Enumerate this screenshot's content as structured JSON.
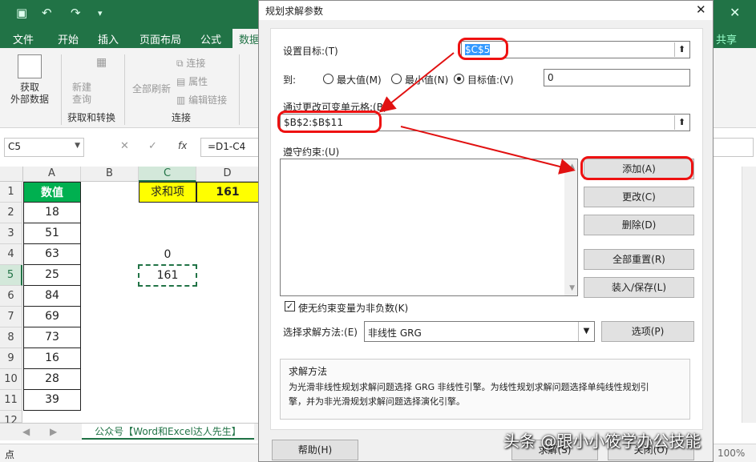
{
  "qat": {
    "icons": [
      "save-icon",
      "undo-icon",
      "redo-icon",
      "customize-icon"
    ]
  },
  "ribbon_tabs": [
    "文件",
    "开始",
    "插入",
    "页面布局",
    "公式",
    "数据"
  ],
  "share_label": "共享",
  "ribbon": {
    "get_external": "获取\n外部数据",
    "new_query": "新建\n查询",
    "refresh_all": "全部刷新",
    "connections": "连接",
    "properties": "属性",
    "edit_links": "编辑链接",
    "group1": "获取和转换",
    "group2": "连接"
  },
  "formula_bar": {
    "name_box": "C5",
    "fx": "fx",
    "formula": "=D1-C4"
  },
  "columns": [
    "A",
    "B",
    "C",
    "D"
  ],
  "rows": [
    "1",
    "2",
    "3",
    "4",
    "5",
    "6",
    "7",
    "8",
    "9",
    "10",
    "11",
    "12"
  ],
  "cells": {
    "A1": "数值",
    "A_values": [
      "18",
      "51",
      "63",
      "25",
      "84",
      "69",
      "73",
      "16",
      "28",
      "39"
    ],
    "C1": "求和项",
    "D1": "161",
    "C4": "0",
    "C5": "161"
  },
  "sheet_tab": "公众号【Word和Excel达人先生】",
  "status": {
    "left": "点",
    "zoom": "100%"
  },
  "dialog": {
    "title": "规划求解参数",
    "set_objective_label": "设置目标:(T)",
    "objective_value": "$C$5",
    "to_label": "到:",
    "max_label": "最大值(M)",
    "min_label": "最小值(N)",
    "target_label": "目标值:(V)",
    "target_value": "0",
    "changing_label": "通过更改可变单元格:(B)",
    "changing_value": "$B$2:$B$11",
    "constraints_label": "遵守约束:(U)",
    "add": "添加(A)",
    "change": "更改(C)",
    "delete": "删除(D)",
    "reset_all": "全部重置(R)",
    "load_save": "装入/保存(L)",
    "nonneg_label": "使无约束变量为非负数(K)",
    "method_label": "选择求解方法:(E)",
    "method_value": "非线性 GRG",
    "options": "选项(P)",
    "desc_title": "求解方法",
    "desc_line1": "为光滑非线性规划求解问题选择 GRG 非线性引擎。为线性规划求解问题选择单纯线性规划引",
    "desc_line2": "擎，并为非光滑规划求解问题选择演化引擎。",
    "help": "帮助(H)",
    "solve": "求解(S)",
    "close": "关闭(O)"
  },
  "watermark": "头条 @跟小小筱学办公技能",
  "colors": {
    "excel_green": "#217346",
    "header_green": "#00b050",
    "yellow": "#ffff00",
    "annotation_red": "#e11111"
  }
}
